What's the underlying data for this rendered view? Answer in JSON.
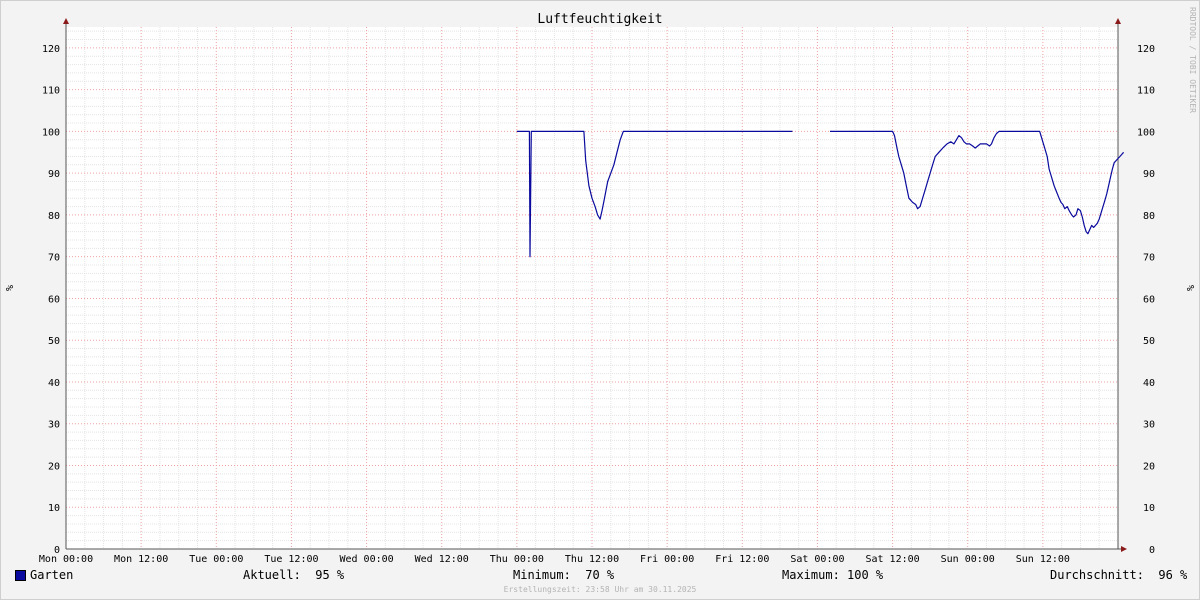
{
  "chart_data": {
    "type": "line",
    "title": "Luftfeuchtigkeit",
    "ylabel": "%",
    "ylabel_right": "%",
    "ylim": [
      0,
      125
    ],
    "y_ticks": [
      0,
      10,
      20,
      30,
      40,
      50,
      60,
      70,
      80,
      90,
      100,
      110,
      120
    ],
    "x_ticks": [
      "Mon 00:00",
      "Mon 12:00",
      "Tue 00:00",
      "Tue 12:00",
      "Wed 00:00",
      "Wed 12:00",
      "Thu 00:00",
      "Thu 12:00",
      "Fri 00:00",
      "Fri 12:00",
      "Sat 00:00",
      "Sat 12:00",
      "Sun 00:00",
      "Sun 12:00"
    ],
    "x_unit": "hours since Mon 00:00",
    "xlim": [
      0,
      168
    ],
    "grid": true,
    "series": [
      {
        "name": "Garten",
        "color": "#0a0a9e",
        "segments": [
          [
            [
              72,
              100
            ],
            [
              74,
              100
            ],
            [
              74,
              100
            ],
            [
              74.1,
              70
            ],
            [
              74.3,
              100
            ],
            [
              76,
              100
            ],
            [
              78,
              100
            ],
            [
              80,
              100
            ],
            [
              82,
              100
            ],
            [
              82.7,
              100
            ],
            [
              83,
              93
            ],
            [
              83.5,
              87
            ],
            [
              84,
              84
            ],
            [
              84.5,
              82
            ],
            [
              84.9,
              80
            ],
            [
              85.3,
              79
            ],
            [
              85.6,
              81
            ],
            [
              86,
              84
            ],
            [
              86.5,
              88
            ],
            [
              87,
              90
            ],
            [
              87.5,
              92
            ],
            [
              88,
              95
            ],
            [
              88.5,
              98
            ],
            [
              89,
              100
            ],
            [
              92,
              100
            ],
            [
              96,
              100
            ],
            [
              100,
              100
            ],
            [
              104,
              100
            ],
            [
              108,
              100
            ],
            [
              112,
              100
            ],
            [
              116,
              100
            ],
            [
              116,
              100
            ]
          ],
          [
            [
              122,
              100
            ],
            [
              124,
              100
            ],
            [
              128,
              100
            ],
            [
              132,
              100
            ],
            [
              132.3,
              99
            ],
            [
              132.7,
              96
            ],
            [
              133,
              94
            ],
            [
              133.4,
              92
            ],
            [
              133.8,
              90
            ],
            [
              134.2,
              87
            ],
            [
              134.6,
              84
            ],
            [
              135.2,
              83
            ],
            [
              135.7,
              82.5
            ],
            [
              136,
              81.5
            ],
            [
              136.4,
              82
            ],
            [
              136.8,
              84
            ],
            [
              137.2,
              86
            ],
            [
              137.6,
              88
            ],
            [
              138,
              90
            ],
            [
              138.4,
              92
            ],
            [
              138.8,
              94
            ],
            [
              139.4,
              95
            ],
            [
              140,
              96
            ],
            [
              140.7,
              97
            ],
            [
              141.3,
              97.5
            ],
            [
              141.8,
              97
            ],
            [
              142.2,
              98
            ],
            [
              142.6,
              99
            ],
            [
              143,
              98.5
            ],
            [
              143.4,
              97.5
            ],
            [
              143.8,
              97
            ],
            [
              144.3,
              97
            ],
            [
              144.8,
              96.5
            ],
            [
              145.2,
              96
            ],
            [
              145.6,
              96.5
            ],
            [
              146,
              97
            ],
            [
              146.5,
              97
            ],
            [
              147,
              97
            ],
            [
              147.5,
              96.5
            ],
            [
              147.8,
              97
            ],
            [
              148.2,
              98.5
            ],
            [
              148.6,
              99.5
            ],
            [
              149,
              100
            ],
            [
              152,
              100
            ],
            [
              155,
              100
            ],
            [
              155.5,
              100
            ],
            [
              155.9,
              98
            ],
            [
              156.3,
              96
            ],
            [
              156.7,
              94
            ],
            [
              157,
              91
            ],
            [
              157.4,
              89
            ],
            [
              157.8,
              87
            ],
            [
              158.2,
              85.5
            ],
            [
              158.6,
              84
            ],
            [
              158.9,
              83
            ],
            [
              159.2,
              82.5
            ],
            [
              159.5,
              81.5
            ],
            [
              159.9,
              82
            ],
            [
              160.2,
              81
            ],
            [
              160.6,
              80
            ],
            [
              160.9,
              79.5
            ],
            [
              161.3,
              80
            ],
            [
              161.6,
              81.5
            ],
            [
              162,
              81
            ],
            [
              162.3,
              79.5
            ],
            [
              162.6,
              77.5
            ],
            [
              162.9,
              76
            ],
            [
              163.2,
              75.5
            ],
            [
              163.5,
              76.5
            ],
            [
              163.8,
              77.5
            ],
            [
              164.1,
              77
            ],
            [
              164.4,
              77.5
            ],
            [
              164.7,
              78
            ],
            [
              165,
              79
            ],
            [
              165.3,
              80.5
            ],
            [
              165.6,
              82
            ],
            [
              165.9,
              83.5
            ],
            [
              166.2,
              85
            ],
            [
              166.5,
              87
            ],
            [
              166.8,
              89
            ],
            [
              167.1,
              91
            ],
            [
              167.4,
              92.5
            ],
            [
              167.7,
              93
            ],
            [
              168,
              93.5
            ],
            [
              168.3,
              94
            ],
            [
              168.6,
              94.5
            ],
            [
              168.9,
              95
            ]
          ]
        ]
      }
    ]
  },
  "legend": {
    "series_name": "Garten",
    "current": "Aktuell:  95 %",
    "minimum": "Minimum:  70 %",
    "maximum": "Maximum: 100 %",
    "average": "Durchschnitt:  96 %"
  },
  "watermark": "RRDTOOL / TOBI OETIKER",
  "footer": "Erstellungszeit: 23:58 Uhr am 30.11.2025"
}
